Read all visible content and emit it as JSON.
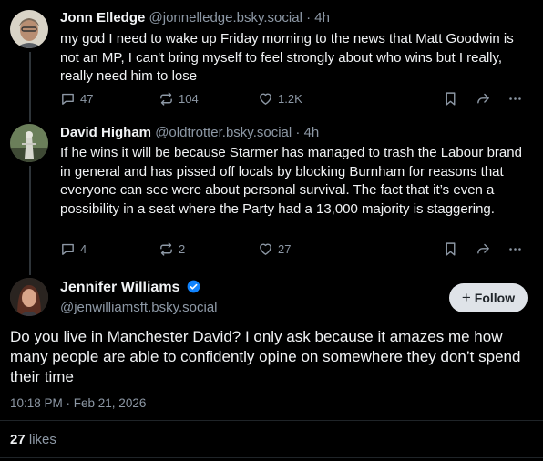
{
  "posts": [
    {
      "name": "Jonn Elledge",
      "handle": "@jonnelledge.bsky.social",
      "time": "4h",
      "text": "my god I need to wake up Friday morning to the news that Matt Goodwin is not an MP, I can't bring myself to feel strongly about who wins but I really, really need him to lose",
      "replies": "47",
      "reposts": "104",
      "likes": "1.2K"
    },
    {
      "name": "David Higham",
      "handle": "@oldtrotter.bsky.social",
      "time": "4h",
      "text": "If he wins it will be because Starmer has managed to trash the Labour brand in general and has pissed off locals by blocking Burnham for reasons that everyone can see were about personal survival. The fact that it’s even a possibility in a seat where the Party had a 13,000 majority is staggering.",
      "replies": "4",
      "reposts": "2",
      "likes": "27"
    }
  ],
  "main_post": {
    "name": "Jennifer Williams",
    "handle": "@jenwilliamsft.bsky.social",
    "follow_label": "Follow",
    "text": "Do you live in Manchester David? I only ask because it amazes me how many people are able to confidently opine on somewhere they don’t spend their time",
    "timestamp": "10:18 PM · Feb 21, 2026",
    "like_count": "27",
    "like_label": "likes"
  },
  "colors": {
    "background": "#000000",
    "text": "#f1f3f5",
    "muted": "#8d98a5",
    "verified": "#1083fe"
  }
}
